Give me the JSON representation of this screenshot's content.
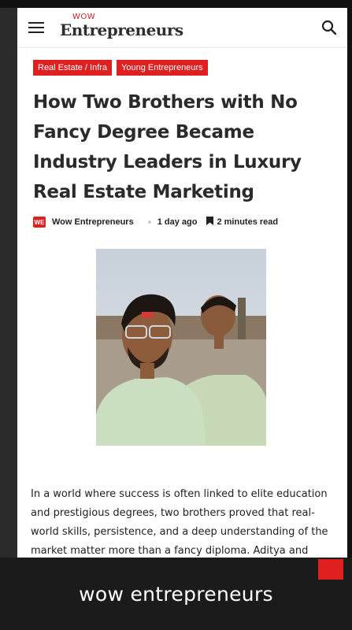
{
  "header": {
    "logo_small": "WOW",
    "logo_main": "Entrepreneurs"
  },
  "article": {
    "tags": [
      "Real Estate / Infra",
      "Young Entrepreneurs"
    ],
    "title": "How Two Brothers with No Fancy Degree Became Industry Leaders in Luxury Real Estate Marketing",
    "author_badge": "WE",
    "author": "Wow Entrepreneurs",
    "time": "1 day ago",
    "read_time": "2 minutes read",
    "body": "In a world where success is often linked to elite education and prestigious degrees, two brothers proved that real-world skills, persistence, and a deep understanding of the market matter more than a fancy diploma. Aditya and Ashwin Jha, the"
  },
  "caption": "wow entrepreneurs",
  "colors": {
    "accent": "#e02020",
    "text": "#2a2a2a",
    "caption_bg": "#1b1b1b"
  },
  "icons": {
    "menu": "hamburger-menu-icon",
    "search": "search-icon",
    "bookmark": "bookmark-icon",
    "scroll_top": "scroll-to-top-icon"
  }
}
